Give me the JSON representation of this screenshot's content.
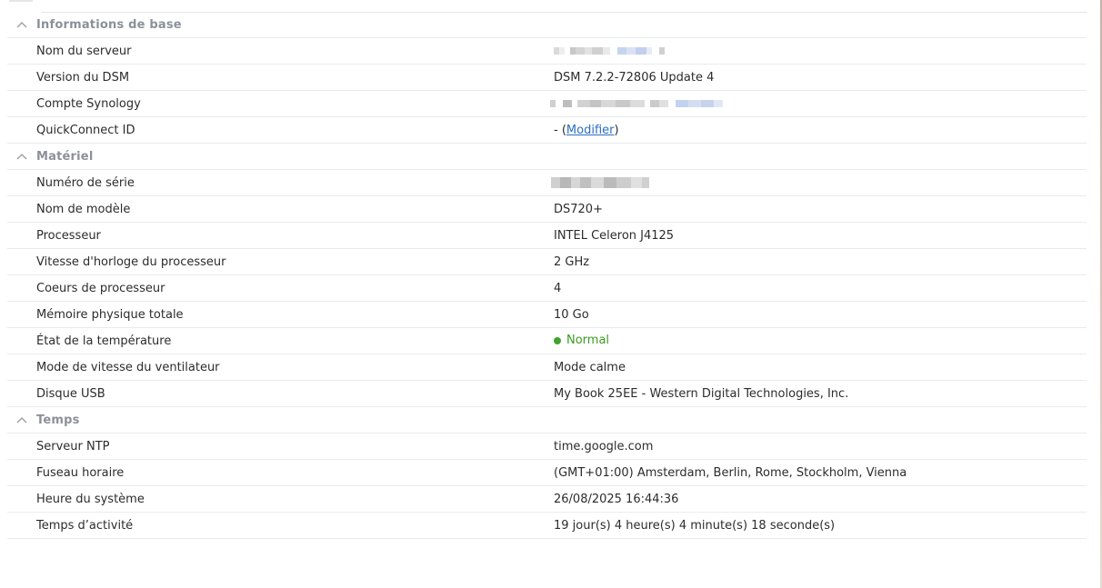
{
  "sections": [
    {
      "title": "Informations de base",
      "rows": [
        {
          "label": "Nom du serveur",
          "value": "",
          "redacted": true
        },
        {
          "label": "Version du DSM",
          "value": "DSM 7.2.2-72806 Update 4"
        },
        {
          "label": "Compte Synology",
          "value": "",
          "redacted": true
        },
        {
          "label": "QuickConnect ID",
          "value_prefix": "- (",
          "link": "Modifier",
          "value_suffix": ")"
        }
      ]
    },
    {
      "title": "Matériel",
      "rows": [
        {
          "label": "Numéro de série",
          "value": "",
          "redacted": true
        },
        {
          "label": "Nom de modèle",
          "value": "DS720+"
        },
        {
          "label": "Processeur",
          "value": "INTEL Celeron J4125"
        },
        {
          "label": "Vitesse d'horloge du processeur",
          "value": "2 GHz"
        },
        {
          "label": "Coeurs de processeur",
          "value": "4"
        },
        {
          "label": "Mémoire physique totale",
          "value": "10 Go"
        },
        {
          "label": "État de la température",
          "value": "Normal",
          "status": "normal",
          "status_color": "#3c9a20"
        },
        {
          "label": "Mode de vitesse du ventilateur",
          "value": "Mode calme"
        },
        {
          "label": "Disque USB",
          "value": "My Book 25EE - Western Digital Technologies, Inc."
        }
      ]
    },
    {
      "title": "Temps",
      "rows": [
        {
          "label": "Serveur NTP",
          "value": "time.google.com"
        },
        {
          "label": "Fuseau horaire",
          "value": "(GMT+01:00) Amsterdam, Berlin, Rome, Stockholm, Vienna"
        },
        {
          "label": "Heure du système",
          "value": "26/08/2025 16:44:36"
        },
        {
          "label": "Temps d’activité",
          "value": "19 jour(s) 4 heure(s) 4 minute(s) 18 seconde(s)"
        }
      ]
    }
  ],
  "icons": {
    "section_toggle": "chevron-up-icon",
    "status_dot": "status-dot-icon"
  },
  "colors": {
    "link": "#2a6fc2",
    "section_title": "#8b9199",
    "status_normal": "#3c9a20"
  }
}
